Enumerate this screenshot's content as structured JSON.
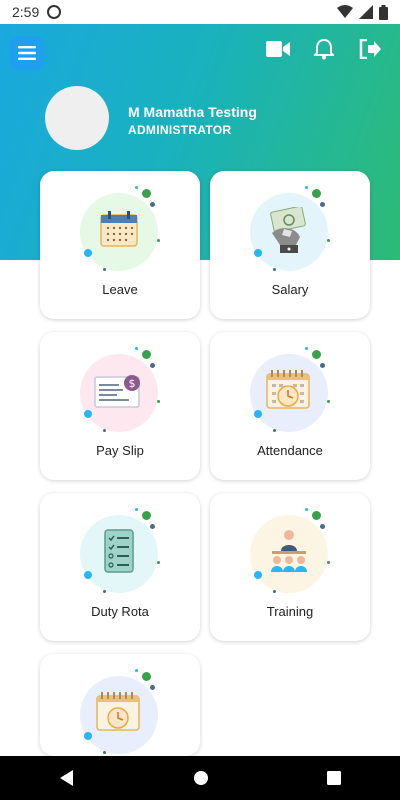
{
  "status_bar": {
    "time": "2:59"
  },
  "user": {
    "name": "M Mamatha Testing",
    "role": "ADMINISTRATOR"
  },
  "colors": {
    "header_start": "#1aa8de",
    "header_end": "#2dbb75",
    "menu_button": "#1e9ff0"
  },
  "icons": {
    "menu": "menu-icon",
    "video": "video-camera-icon",
    "notifications": "bell-icon",
    "logout": "logout-icon"
  },
  "tiles": [
    {
      "label": "Leave",
      "icon": "calendar-icon",
      "blob": "#e6f8e6"
    },
    {
      "label": "Salary",
      "icon": "money-hand-icon",
      "blob": "#e3f5fb"
    },
    {
      "label": "Pay Slip",
      "icon": "payslip-icon",
      "blob": "#fde8f0"
    },
    {
      "label": "Attendance",
      "icon": "attendance-icon",
      "blob": "#e8eefc"
    },
    {
      "label": "Duty Rota",
      "icon": "checklist-icon",
      "blob": "#e3f6f8"
    },
    {
      "label": "Training",
      "icon": "training-icon",
      "blob": "#fdf5e3"
    },
    {
      "label": "",
      "icon": "attendance-icon",
      "blob": "#e8eefc"
    }
  ]
}
